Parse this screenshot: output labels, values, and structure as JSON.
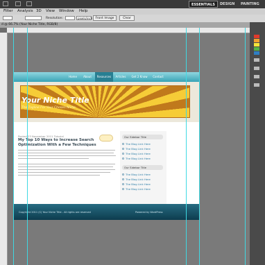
{
  "workspace": {
    "items": [
      {
        "label": "ESSENTIALS",
        "active": true
      },
      {
        "label": "DESIGN",
        "active": false
      },
      {
        "label": "PAINTING",
        "active": false
      }
    ]
  },
  "menubar": {
    "items": [
      "Filter",
      "Analysis",
      "3D",
      "View",
      "Window",
      "Help"
    ]
  },
  "options": {
    "resolution_label": "Resolution:",
    "unit_value": "pixels/inch",
    "front_image_label": "Front Image",
    "clear_label": "Clear"
  },
  "document": {
    "tab_title": "d @ 66.7% (Your Niche Title, RGB/8)",
    "zoom": "66.7%"
  },
  "mockup": {
    "nav": [
      "Home",
      "About",
      "Resources",
      "Articles",
      "Get 2 Know",
      "Contact"
    ],
    "active_nav": "Resources",
    "site_title": "Your Niche Title",
    "tagline": "The Tagline For Your Chosen Niche",
    "post_meta": "Posted 23 November 2011 Tutorial",
    "post_title": "My Top 10 Ways to Increase Search Optimization With a Few Techniques",
    "sidebar": [
      {
        "heading": "Our Sidebar Title",
        "links": [
          "The Blog Link Here",
          "The Blog Link Here",
          "The Blog Link Here",
          "The Blog Link Here"
        ]
      },
      {
        "heading": "Our Sidebar Title",
        "links": [
          "The Blog Link Here",
          "The Blog Link Here",
          "The Blog Link Here",
          "The Blog Link Here"
        ]
      }
    ],
    "footer_copyright": "Copyright 2011 (C) Your Niche Title - All rights are reserved",
    "footer_powered": "Powered by WordPress"
  },
  "colors": {
    "nav": "#39a3b5",
    "guide": "#3fd9e3",
    "footer": "#0d3c4e",
    "banner_light": "#f6cc37",
    "banner_dark": "#c0791c"
  }
}
